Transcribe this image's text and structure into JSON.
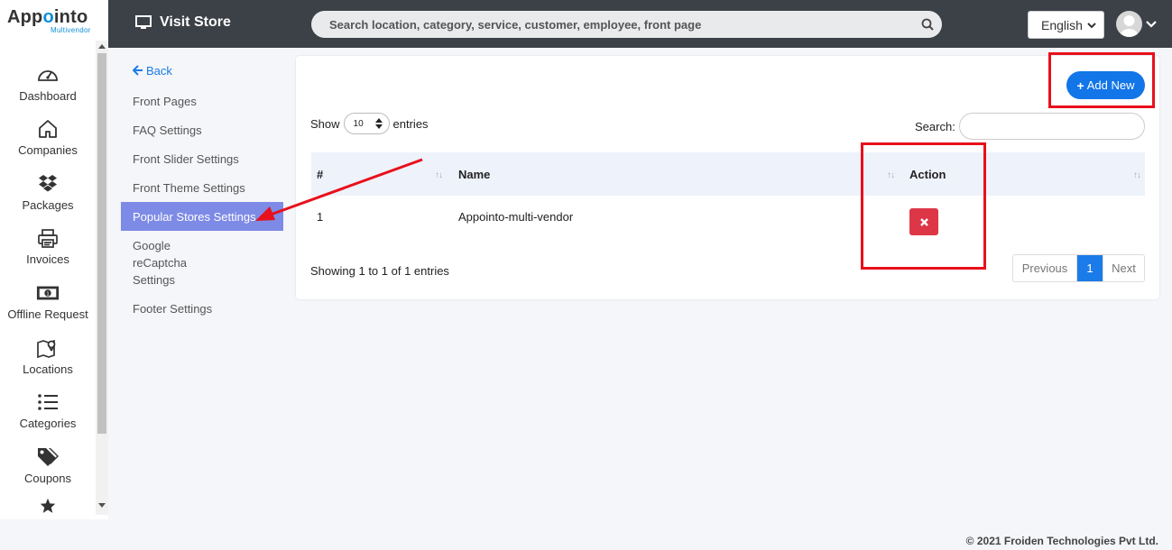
{
  "brand": {
    "name_part1": "App",
    "name_part2": "o",
    "name_part3": "into",
    "subtitle": "Multivendor"
  },
  "sidebar": {
    "items": [
      {
        "label": "Dashboard",
        "icon": "dashboard-gauge-icon"
      },
      {
        "label": "Companies",
        "icon": "home-icon"
      },
      {
        "label": "Packages",
        "icon": "dropbox-icon"
      },
      {
        "label": "Invoices",
        "icon": "printer-icon"
      },
      {
        "label": "Offline Request",
        "icon": "money-bill-icon"
      },
      {
        "label": "Locations",
        "icon": "map-pin-icon"
      },
      {
        "label": "Categories",
        "icon": "list-icon"
      },
      {
        "label": "Coupons",
        "icon": "tags-icon"
      },
      {
        "label": "",
        "icon": "star-icon"
      }
    ]
  },
  "topbar": {
    "visit_store": "Visit Store",
    "search_placeholder": "Search location, category, service, customer, employee, front page",
    "language": "English"
  },
  "subnav": {
    "back": "Back",
    "items": [
      "Front Pages",
      "FAQ Settings",
      "Front Slider Settings",
      "Front Theme Settings",
      "Popular Stores Settings",
      "Google reCaptcha Settings",
      "Footer Settings"
    ],
    "active_index": 4
  },
  "card": {
    "add_new": "Add New",
    "show_label": "Show",
    "entries_label": "entries",
    "page_length": "10",
    "search_label": "Search:",
    "columns": [
      "#",
      "Name",
      "Action"
    ],
    "rows": [
      {
        "index": "1",
        "name": "Appointo-multi-vendor"
      }
    ],
    "info": "Showing 1 to 1 of 1 entries",
    "pagination": {
      "previous": "Previous",
      "current": "1",
      "next": "Next"
    }
  },
  "colors": {
    "accent": "#1275e8",
    "active_nav": "#7d8ae6",
    "danger": "#dd3646",
    "annotation": "#e8101b",
    "topbar": "#3c4047"
  },
  "footer": "© 2021 Froiden Technologies Pvt Ltd."
}
